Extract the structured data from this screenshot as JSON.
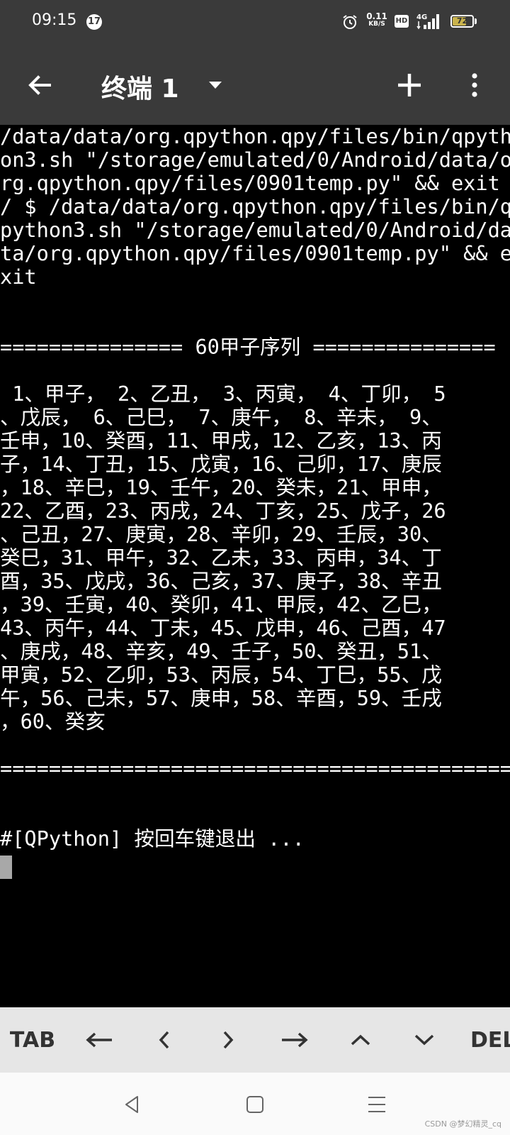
{
  "status_bar": {
    "time": "09:15",
    "notification_badge": "17",
    "net_speed_value": "0.11",
    "net_speed_unit": "KB/S",
    "hd_label": "HD",
    "signal_label": "4G",
    "battery_level": "72"
  },
  "app_bar": {
    "title": "终端 1"
  },
  "terminal": {
    "lines": [
      "/data/data/org.qpython.qpy/files/bin/qpyth",
      "on3.sh \"/storage/emulated/0/Android/data/o",
      "rg.qpython.qpy/files/0901temp.py\" && exit",
      "/ $ /data/data/org.qpython.qpy/files/bin/q",
      "python3.sh \"/storage/emulated/0/Android/da",
      "ta/org.qpython.qpy/files/0901temp.py\" && e",
      "xit",
      "",
      "",
      "=============== 60甲子序列 ===============",
      "",
      " 1、甲子， 2、乙丑， 3、丙寅， 4、丁卯， 5",
      "、戊辰， 6、己巳， 7、庚午， 8、辛未， 9、",
      "壬申，10、癸酉，11、甲戌，12、乙亥，13、丙",
      "子，14、丁丑，15、戊寅，16、己卯，17、庚辰",
      "，18、辛巳，19、壬午，20、癸未，21、甲申，",
      "22、乙酉，23、丙戌，24、丁亥，25、戊子，26",
      "、己丑，27、庚寅，28、辛卯，29、壬辰，30、",
      "癸巳，31、甲午，32、乙未，33、丙申，34、丁",
      "酉，35、戊戌，36、己亥，37、庚子，38、辛丑",
      "，39、壬寅，40、癸卯，41、甲辰，42、乙巳，",
      "43、丙午，44、丁未，45、戊申，46、己酉，47",
      "、庚戌，48、辛亥，49、壬子，50、癸丑，51、",
      "甲寅，52、乙卯，53、丙辰，54、丁巳，55、戊",
      "午，56、己未，57、庚申，58、辛酉，59、壬戌",
      "，60、癸亥",
      "",
      "==========================================",
      "",
      "",
      "#[QPython] 按回车键退出 ..."
    ]
  },
  "extra_keys": {
    "tab": "TAB",
    "left_arrow": "←",
    "lt": "‹",
    "gt": "›",
    "right_arrow": "→",
    "up": "︿",
    "down": "﹀",
    "del": "DEL"
  },
  "watermark": "CSDN @梦幻精灵_cq",
  "colors": {
    "bar_bg": "#3a3a3a",
    "terminal_bg": "#000000",
    "terminal_fg": "#ffffff",
    "cursor": "#a8a8a8",
    "extra_keys_bg": "#e6e6e6",
    "battery_fill": "#c9b34d"
  }
}
